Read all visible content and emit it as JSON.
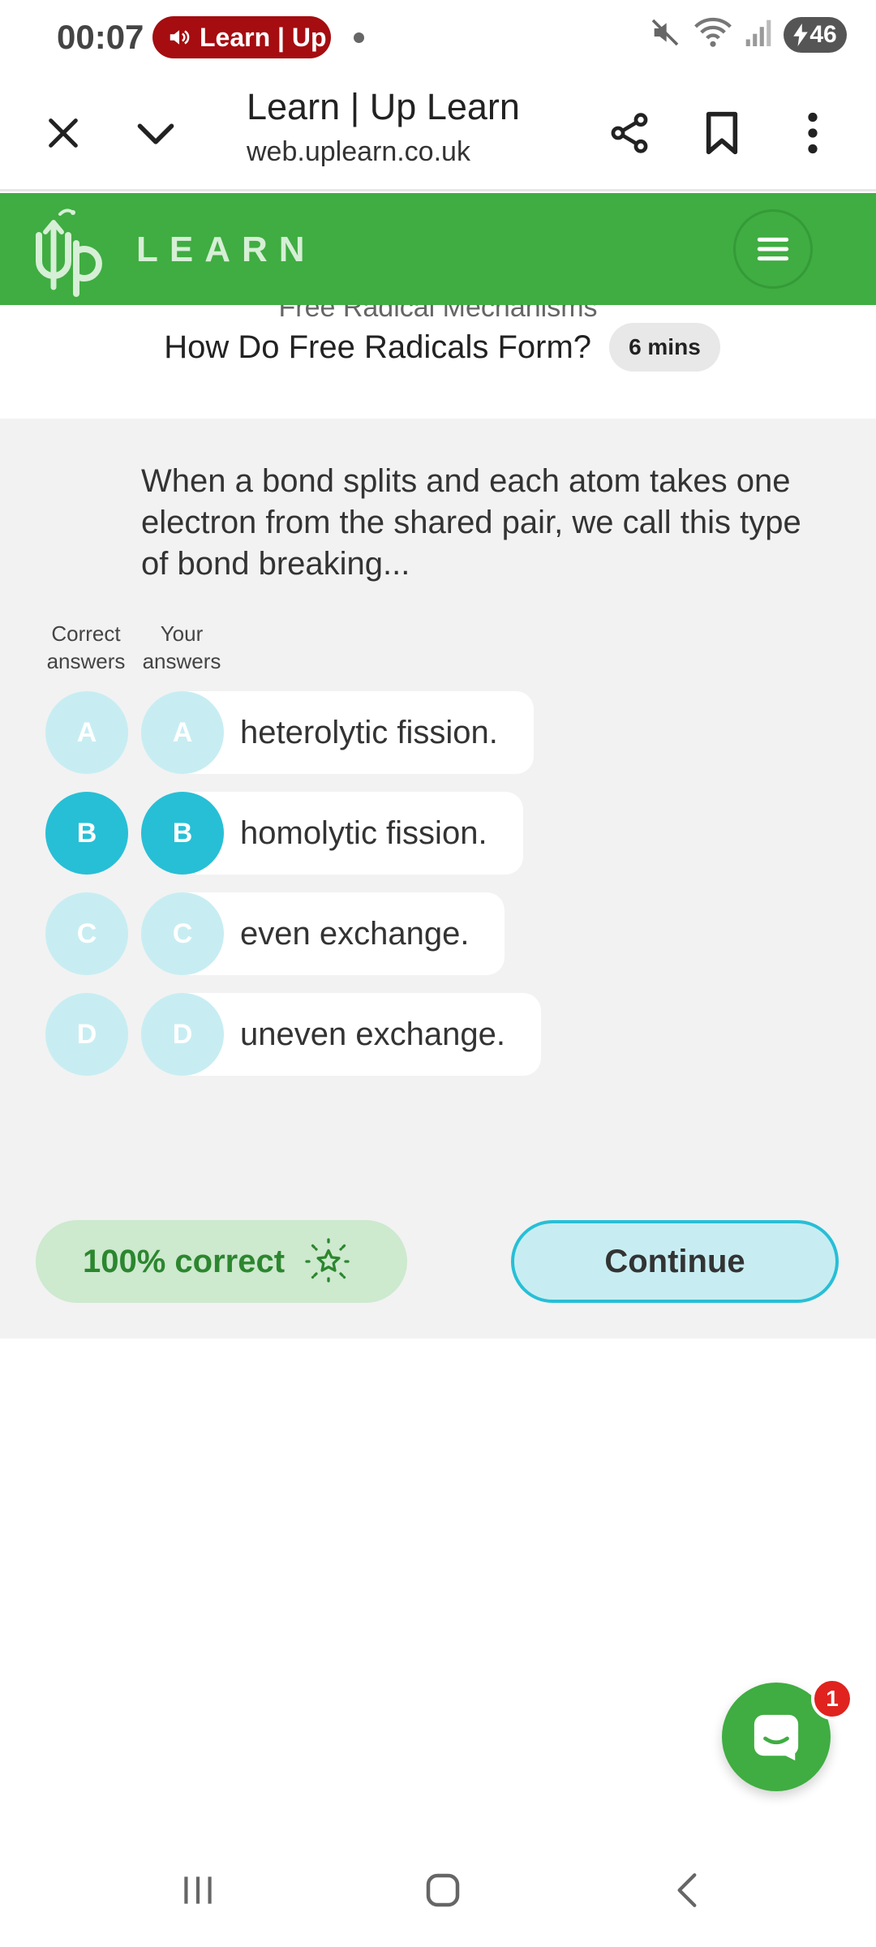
{
  "status_bar": {
    "time": "00:07",
    "media_label": "Learn | Up",
    "battery": "46"
  },
  "browser": {
    "title": "Learn | Up Learn",
    "url": "web.uplearn.co.uk"
  },
  "site": {
    "logo_up": "Up",
    "logo_learn": "LEARN",
    "brand_color": "#3fad41"
  },
  "lesson": {
    "section": "Free Radical Mechanisms",
    "title": "How Do Free Radicals Form?",
    "duration": "6 mins"
  },
  "quiz": {
    "question": "When a bond splits and each atom takes one electron from the shared pair, we call this type of bond breaking...",
    "correct_header": "Correct answers",
    "your_header": "Your answers",
    "options": [
      {
        "letter": "A",
        "text": "heterolytic fission.",
        "correct": false,
        "selected": false
      },
      {
        "letter": "B",
        "text": "homolytic fission.",
        "correct": true,
        "selected": true
      },
      {
        "letter": "C",
        "text": "even exchange.",
        "correct": false,
        "selected": false
      },
      {
        "letter": "D",
        "text": "uneven exchange.",
        "correct": false,
        "selected": false
      }
    ],
    "score": "100% correct",
    "continue_label": "Continue",
    "accent_color": "#27bfd6"
  },
  "chat": {
    "badge_count": "1"
  }
}
